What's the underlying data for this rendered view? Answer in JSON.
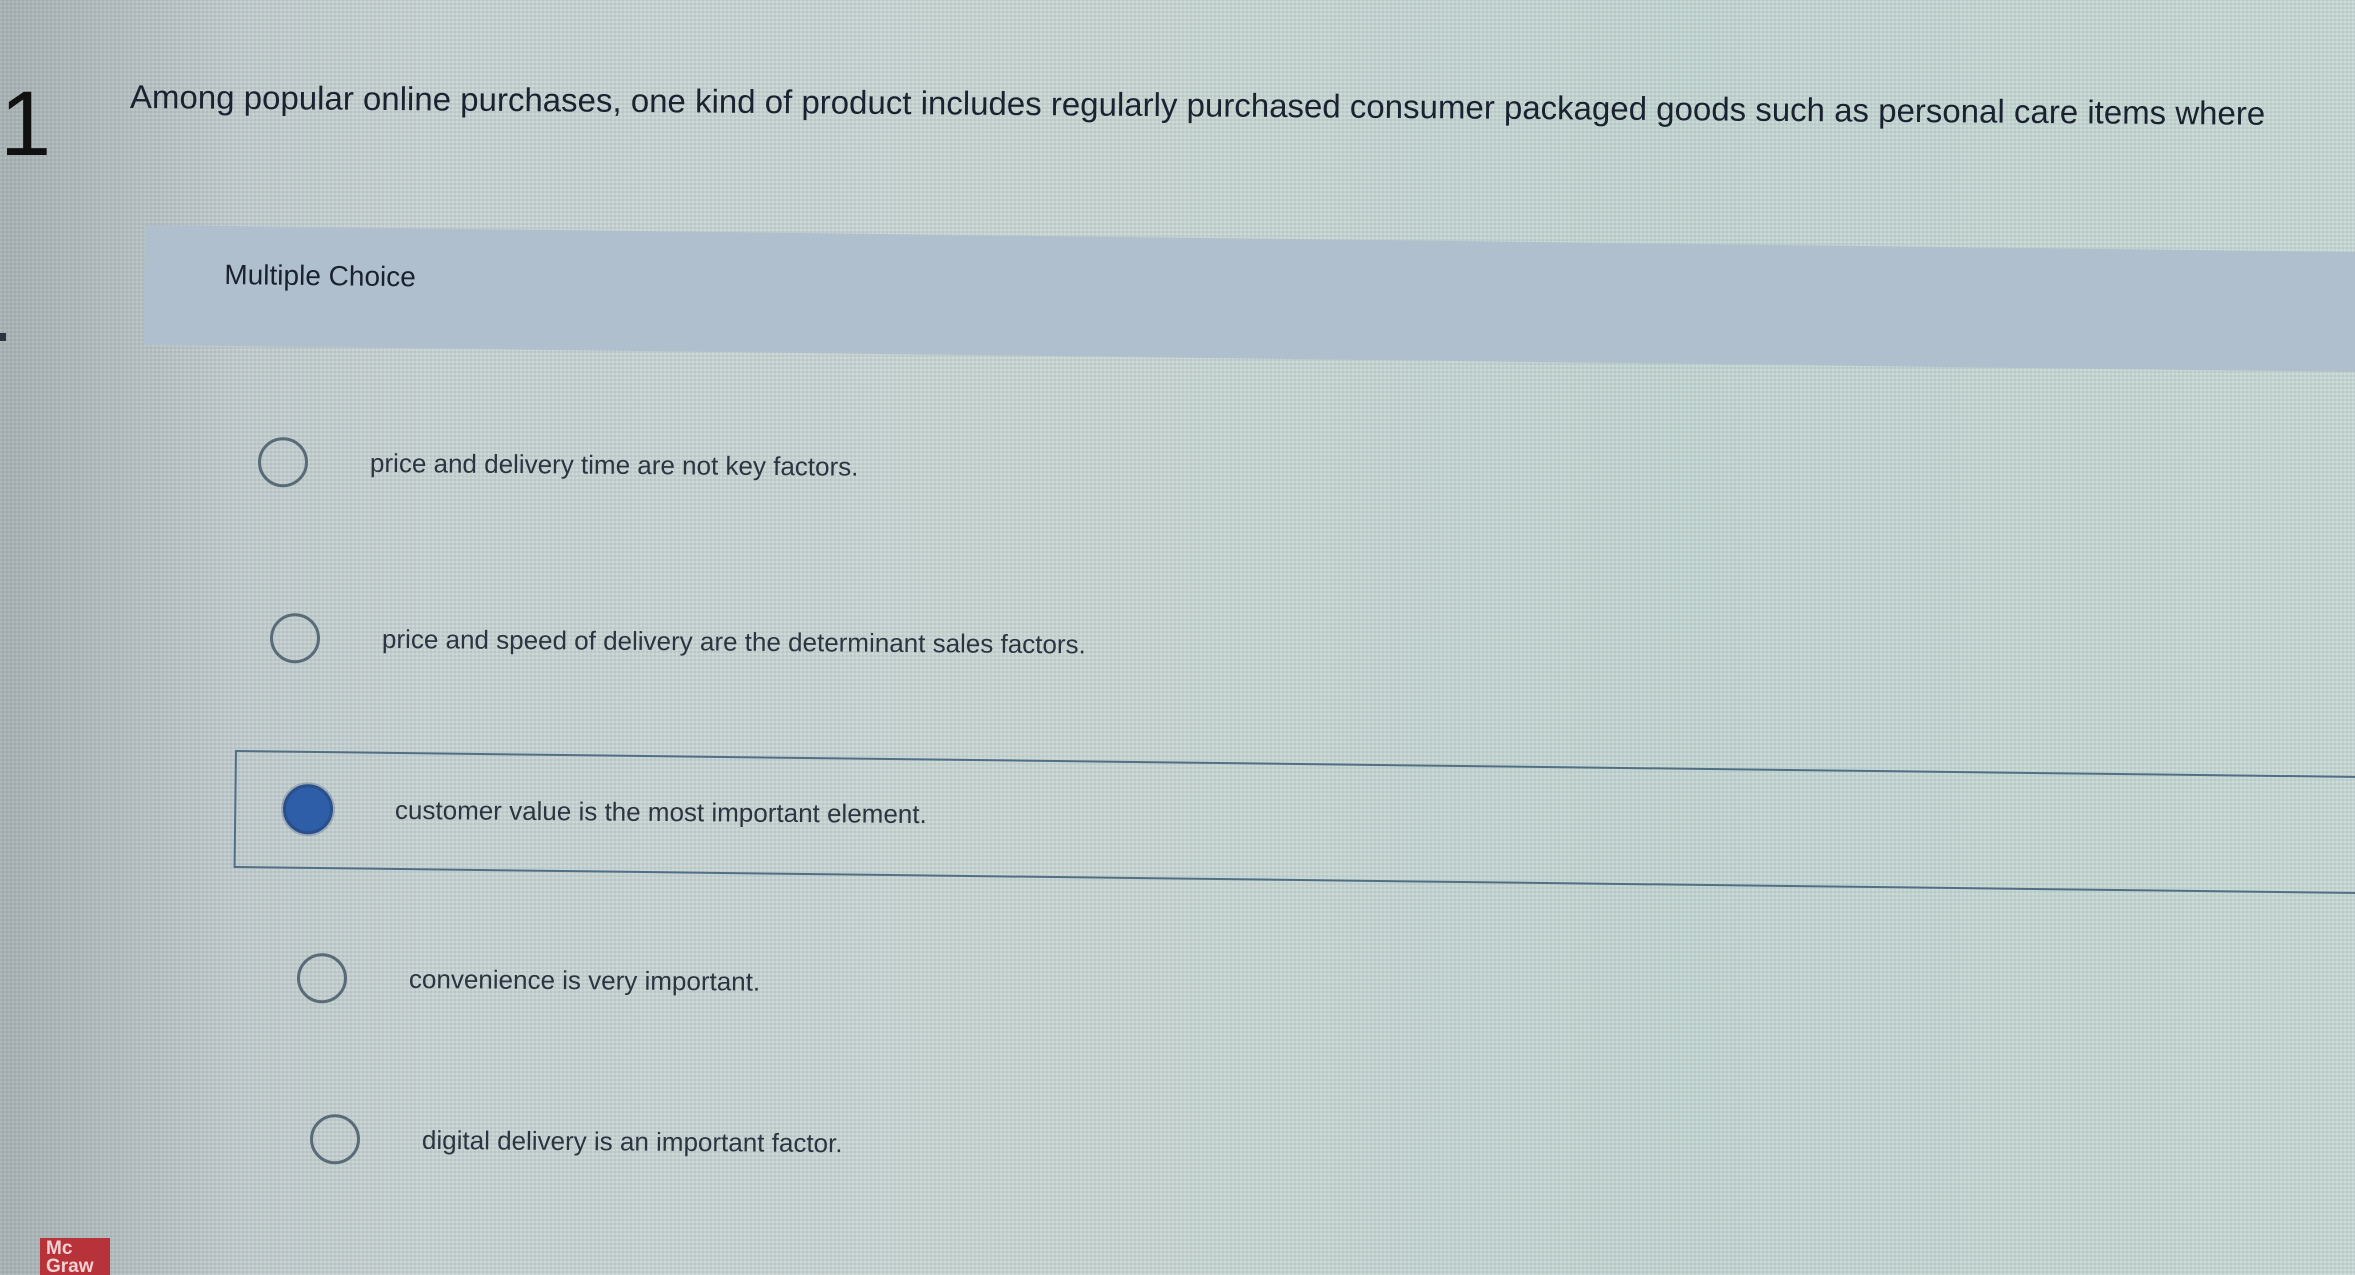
{
  "question": {
    "number": "1",
    "text": "Among popular online purchases, one kind of product includes regularly purchased consumer packaged goods such as personal care items where"
  },
  "answer_section": {
    "label": "Multiple Choice",
    "options": [
      {
        "text": "price and delivery time are not key factors.",
        "selected": false
      },
      {
        "text": "price and speed of delivery are the determinant sales factors.",
        "selected": false
      },
      {
        "text": "customer value is the most important element.",
        "selected": true
      },
      {
        "text": "convenience is very important.",
        "selected": false
      },
      {
        "text": "digital delivery is an important factor.",
        "selected": false
      }
    ]
  },
  "branding": {
    "logo_line1": "Mc",
    "logo_line2": "Graw"
  },
  "colors": {
    "selected_radio": "#2e5ea8",
    "header_band": "#b0bfcd",
    "logo_red": "#b8323a"
  }
}
